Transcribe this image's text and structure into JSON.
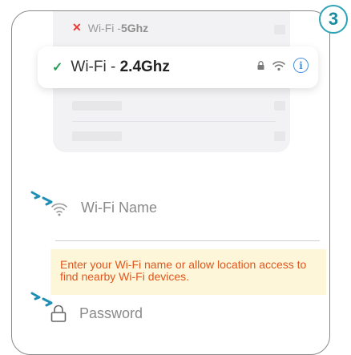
{
  "step_number": "3",
  "networks": {
    "dimmed": {
      "status_icon": "close-icon",
      "prefix": "Wi-Fi - ",
      "band": "5Ghz"
    },
    "selected": {
      "status_icon": "check-icon",
      "prefix": "Wi-Fi - ",
      "band": "2.4Ghz",
      "icons": [
        "lock-icon",
        "wifi-icon",
        "info-icon"
      ],
      "info_glyph": "i"
    }
  },
  "form": {
    "wifi_name_placeholder": "Wi-Fi Name",
    "password_placeholder": "Password",
    "hint": "Enter your Wi-Fi name or allow location access to find nearby Wi-Fi devices."
  },
  "colors": {
    "accent": "#2ea3b5",
    "hint_text": "#e0561e",
    "hint_bg": "#fdf6d8",
    "check": "#2e9e5a",
    "cross": "#e53935",
    "info": "#4a90d9"
  }
}
